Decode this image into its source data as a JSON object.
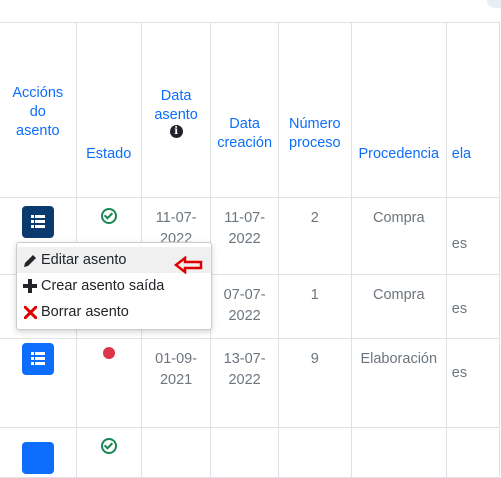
{
  "table": {
    "headers": [
      {
        "label": "Accións do asento",
        "lines": [
          "Accións",
          "do",
          "asento"
        ]
      },
      {
        "label": "Estado",
        "lines": [
          "Estado"
        ]
      },
      {
        "label": "Data asento",
        "lines": [
          "Data",
          "asento"
        ]
      },
      {
        "label": "Data creación",
        "lines": [
          "Data",
          "creación"
        ]
      },
      {
        "label": "Número proceso",
        "lines": [
          "Número",
          "proceso"
        ]
      },
      {
        "label": "Procedencia",
        "lines": [
          "Procedencia"
        ]
      },
      {
        "label": "ela",
        "lines": [
          "ela"
        ]
      }
    ],
    "rows": [
      {
        "status": "ok",
        "data_asento": [
          "11-07-",
          "2022"
        ],
        "data_creacion": [
          "11-07-",
          "2022"
        ],
        "numero": "2",
        "procedencia": "Compra",
        "cut": "es"
      },
      {
        "status": "hidden",
        "data_asento": [
          "",
          ""
        ],
        "data_creacion": [
          "07-07-",
          "2022"
        ],
        "numero": "1",
        "procedencia": "Compra",
        "cut": "es"
      },
      {
        "status": "bad",
        "data_asento": [
          "01-09-",
          "2021"
        ],
        "data_creacion": [
          "13-07-",
          "2022"
        ],
        "numero": "9",
        "procedencia": "Elaboración",
        "cut": "es"
      }
    ]
  },
  "menu": {
    "items": [
      {
        "label": "Editar asento",
        "icon": "pencil-icon"
      },
      {
        "label": "Crear asento saída",
        "icon": "plus-icon"
      },
      {
        "label": "Borrar asento",
        "icon": "x-icon"
      }
    ]
  },
  "colors": {
    "link": "#0d6efd",
    "button": "#0d6efd",
    "button_active": "#0a3a6e",
    "success": "#198754",
    "danger": "#dc3545",
    "arrow": "#e00000"
  }
}
